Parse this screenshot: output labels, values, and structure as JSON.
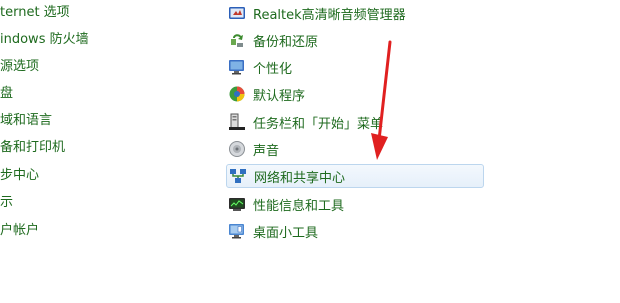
{
  "left_items": [
    {
      "label": "ternet 选项"
    },
    {
      "label": "indows 防火墙"
    },
    {
      "label": "源选项"
    },
    {
      "label": "盘"
    },
    {
      "label": "域和语言"
    },
    {
      "label": "备和打印机"
    },
    {
      "label": "步中心"
    },
    {
      "label": "示"
    },
    {
      "label": "户帐户"
    }
  ],
  "right_items": [
    {
      "label": "Realtek高清晰音频管理器",
      "icon": "realtek-audio-icon"
    },
    {
      "label": "备份和还原",
      "icon": "backup-restore-icon"
    },
    {
      "label": "个性化",
      "icon": "personalization-icon"
    },
    {
      "label": "默认程序",
      "icon": "default-programs-icon"
    },
    {
      "label": "任务栏和「开始」菜单",
      "icon": "taskbar-icon"
    },
    {
      "label": "声音",
      "icon": "sound-icon"
    },
    {
      "label": "网络和共享中心",
      "icon": "network-icon"
    },
    {
      "label": "性能信息和工具",
      "icon": "performance-icon"
    },
    {
      "label": "桌面小工具",
      "icon": "gadgets-icon"
    }
  ],
  "highlighted_item": "网络和共享中心",
  "colors": {
    "link": "#1e6a1e",
    "highlight_border": "#bcd6ee",
    "arrow": "#e02020"
  }
}
